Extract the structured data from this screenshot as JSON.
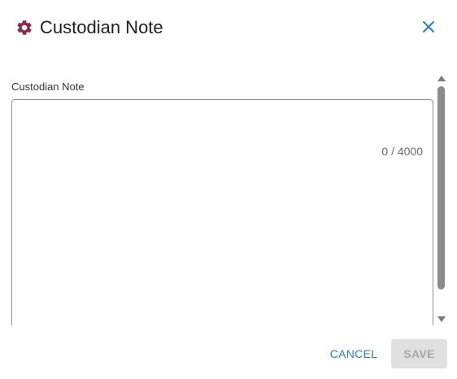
{
  "dialog": {
    "title": "Custodian Note",
    "title_icon": "gear-icon",
    "close_icon": "close-icon"
  },
  "field": {
    "label": "Custodian Note",
    "value": "",
    "counter": "0 / 4000"
  },
  "footer": {
    "cancel_label": "CANCEL",
    "save_label": "SAVE"
  },
  "colors": {
    "icon_accent": "#8b2a4a",
    "link_blue": "#2f7bc4",
    "disabled_bg": "#e0e0e0",
    "disabled_text": "#a7a7a7"
  }
}
